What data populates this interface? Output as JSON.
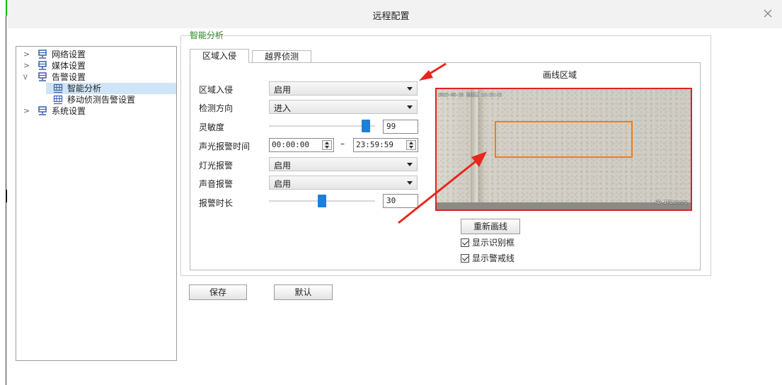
{
  "window": {
    "title": "远程配置"
  },
  "tree": {
    "items": [
      {
        "label": "网络设置",
        "expanded": false,
        "level": 0
      },
      {
        "label": "媒体设置",
        "expanded": false,
        "level": 0
      },
      {
        "label": "告警设置",
        "expanded": true,
        "level": 0
      },
      {
        "label": "智能分析",
        "level": 1,
        "selected": true
      },
      {
        "label": "移动侦测告警设置",
        "level": 1
      },
      {
        "label": "系统设置",
        "expanded": false,
        "level": 0
      }
    ]
  },
  "group": {
    "title": "智能分析"
  },
  "tabs": [
    {
      "label": "区域入侵",
      "active": true
    },
    {
      "label": "越界侦测",
      "active": false
    }
  ],
  "form": {
    "intrusion": {
      "label": "区域入侵",
      "value": "启用"
    },
    "direction": {
      "label": "检测方向",
      "value": "进入"
    },
    "sensitivity": {
      "label": "灵敏度",
      "value": "99",
      "level": 0.95
    },
    "alarm_time": {
      "label": "声光报警时间",
      "start": "00:00:00",
      "dash": "–",
      "end": "23:59:59"
    },
    "light_alarm": {
      "label": "灯光报警",
      "value": "启用"
    },
    "sound_alarm": {
      "label": "声音报警",
      "value": "启用"
    },
    "alarm_duration": {
      "label": "报警时长",
      "value": "30",
      "level": 0.5
    }
  },
  "preview": {
    "title": "画线区域",
    "osd_top": "2023-06-28 星期三 14:33:42",
    "osd_bottom": "HD IPCamera",
    "redraw_button": "重新画线",
    "show_box": {
      "label": "显示识别框",
      "checked": true
    },
    "show_line": {
      "label": "显示警戒线",
      "checked": true
    }
  },
  "footer": {
    "save": "保存",
    "default": "默认"
  },
  "colors": {
    "accent": "#1e7fd8",
    "group_title": "#2a8a2a",
    "zone": "#f07d18",
    "preview_border": "#dd2222",
    "annotation_arrow": "#e8261c"
  }
}
